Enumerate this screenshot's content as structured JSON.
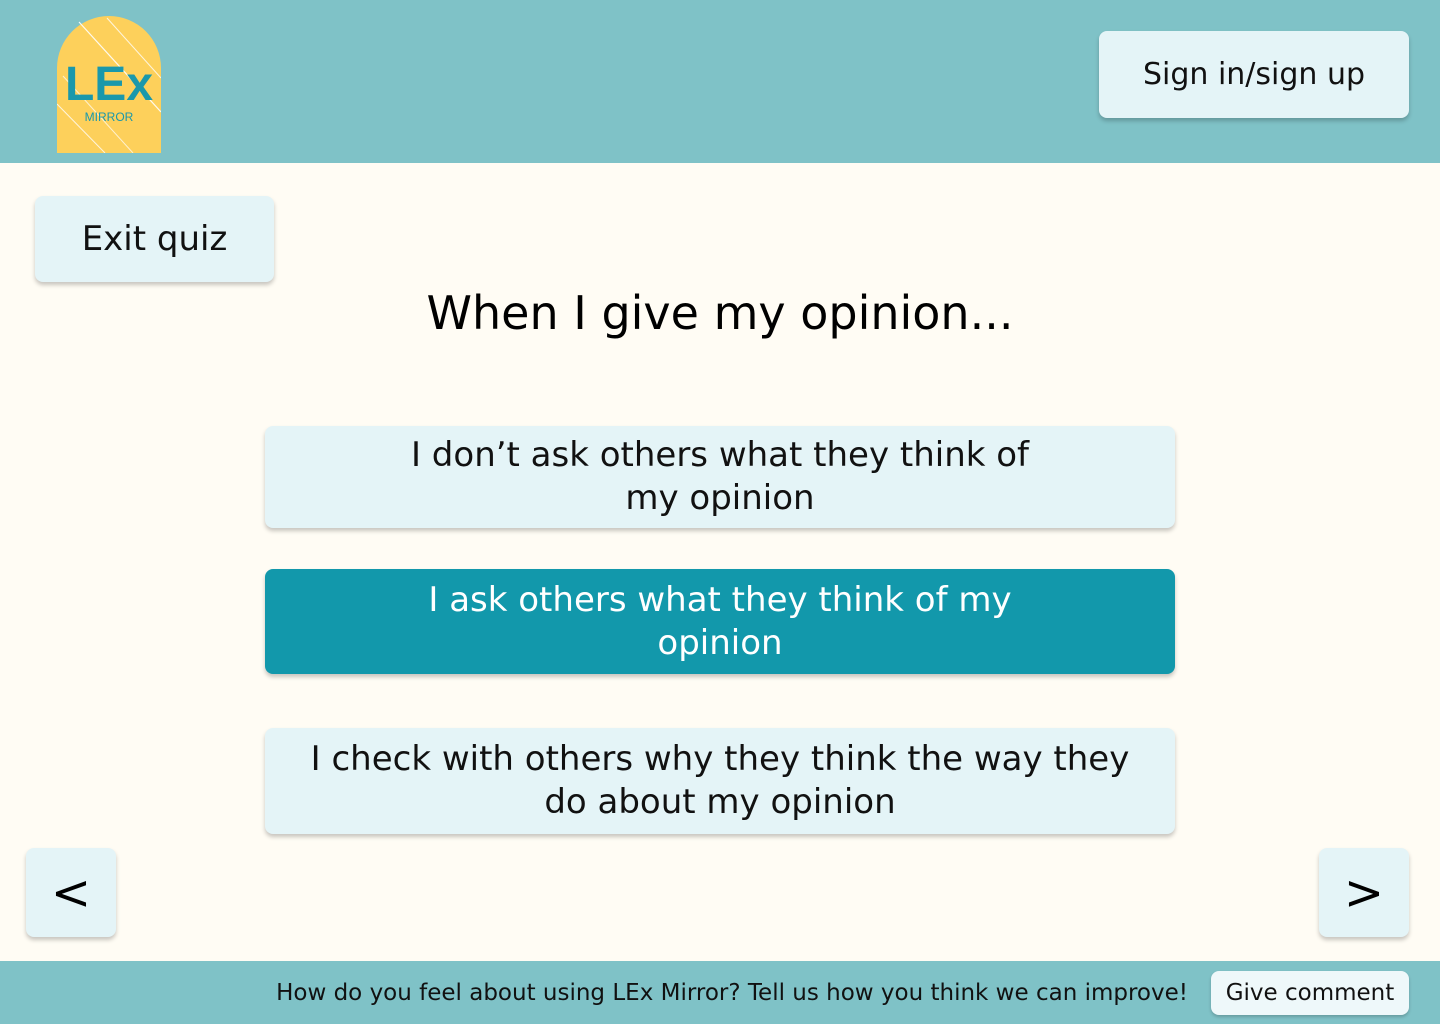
{
  "header": {
    "logo": {
      "text": "LEx",
      "subtext": "MIRROR",
      "bg_color": "#fdd05b",
      "text_color": "#1a98ab"
    },
    "signin_label": "Sign in/sign up"
  },
  "quiz": {
    "exit_label": "Exit quiz",
    "question": "When I give my opinion...",
    "options": [
      {
        "label": "I don’t ask others what they think of my opinion",
        "selected": false
      },
      {
        "label": "I ask others what they think of my opinion",
        "selected": true
      },
      {
        "label": "I check with others why they think the way they do about my opinion",
        "selected": false
      }
    ],
    "prev_label": "<",
    "next_label": ">"
  },
  "footer": {
    "prompt": "How do you feel about using LEx Mirror? Tell us how you think we can improve!",
    "comment_label": "Give comment"
  },
  "colors": {
    "header_bg": "#7fc2c7",
    "page_bg": "#fffcf4",
    "button_bg": "#e4f4f7",
    "selected_bg": "#1298ab"
  }
}
